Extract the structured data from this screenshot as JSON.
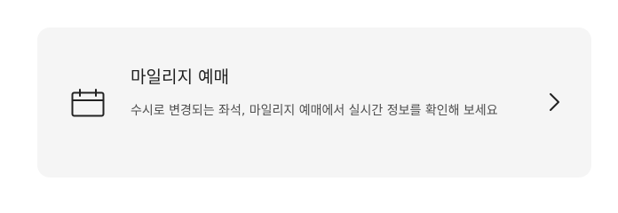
{
  "card": {
    "title": "마일리지 예매",
    "description": "수시로 변경되는 좌석, 마일리지 예매에서 실시간 정보를 확인해 보세요",
    "leading_icon": "calendar-icon",
    "trailing_icon": "chevron-right-icon"
  },
  "colors": {
    "card_background": "#f5f5f5",
    "title": "#1f1f1f",
    "description": "#4e4e4e",
    "icon": "#222222"
  }
}
